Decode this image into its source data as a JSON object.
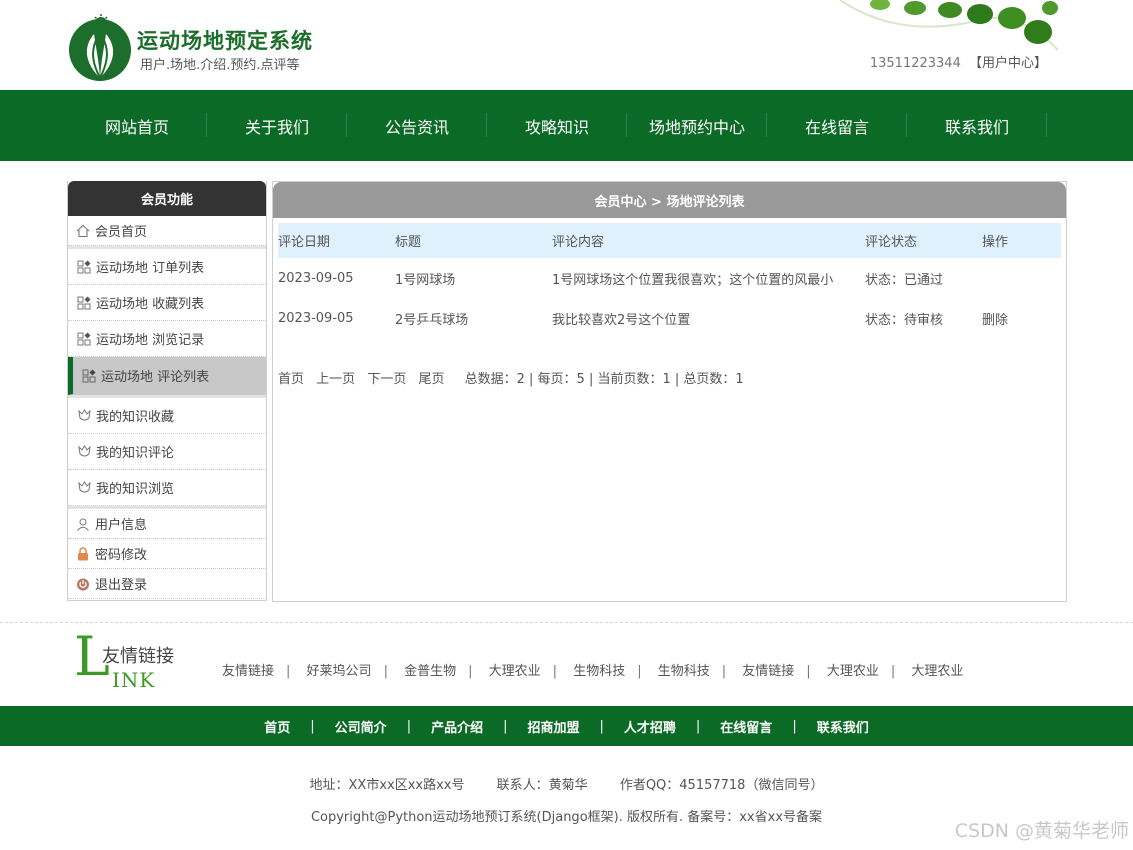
{
  "header": {
    "title": "运动场地预定系统",
    "subtitle": "用户.场地.介绍.预约.点评等",
    "phone": "13511223344",
    "user_center": "【用户中心】"
  },
  "nav": [
    "网站首页",
    "关于我们",
    "公告资讯",
    "攻略知识",
    "场地预约中心",
    "在线留言",
    "联系我们"
  ],
  "sidebar": {
    "title": "会员功能",
    "home": "会员首页",
    "items": [
      "运动场地 订单列表",
      "运动场地 收藏列表",
      "运动场地 浏览记录",
      "运动场地 评论列表"
    ],
    "knowledge": [
      "我的知识收藏",
      "我的知识评论",
      "我的知识浏览"
    ],
    "account": [
      "用户信息",
      "密码修改",
      "退出登录"
    ]
  },
  "main": {
    "breadcrumb": "会员中心 > 场地评论列表",
    "columns": [
      "评论日期",
      "标题",
      "评论内容",
      "评论状态",
      "操作"
    ],
    "rows": [
      {
        "date": "2023-09-05",
        "title": "1号网球场",
        "content": "1号网球场这个位置我很喜欢；这个位置的风最小",
        "status": "状态：已通过",
        "action": ""
      },
      {
        "date": "2023-09-05",
        "title": "2号乒乓球场",
        "content": "我比较喜欢2号这个位置",
        "status": "状态：待审核",
        "action": "删除"
      }
    ],
    "pager": {
      "first": "首页",
      "prev": "上一页",
      "next": "下一页",
      "last": "尾页",
      "summary": "总数据：2 | 每页：5 | 当前页数：1 | 总页数：1"
    }
  },
  "links": {
    "logo_cn": "友情链接",
    "logo_l": "L",
    "logo_ink": "INK",
    "items": [
      "友情链接",
      "好莱坞公司",
      "金普生物",
      "大理农业",
      "生物科技",
      "生物科技",
      "友情链接",
      "大理农业",
      "大理农业"
    ]
  },
  "footer_nav": [
    "首页",
    "公司简介",
    "产品介绍",
    "招商加盟",
    "人才招聘",
    "在线留言",
    "联系我们"
  ],
  "footer": {
    "address": "地址：XX市xx区xx路xx号",
    "contact": "联系人：黄菊华",
    "qq": "作者QQ：45157718（微信同号）",
    "copyright": "Copyright@Python运动场地预订系统(Django框架). 版权所有. 备案号：xx省xx号备案"
  },
  "watermark": "CSDN @黄菊华老师",
  "colors": {
    "brand_green": "#0b6a25",
    "header_bg": "#999999",
    "table_head_bg": "#dff1fc"
  }
}
